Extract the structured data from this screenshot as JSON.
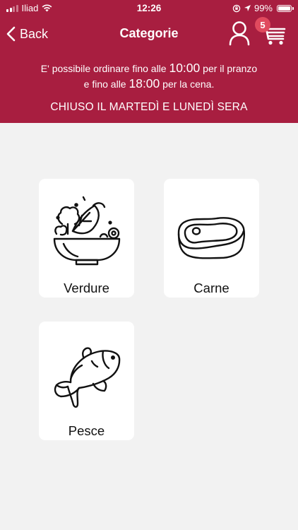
{
  "status_bar": {
    "carrier": "Iliad",
    "time": "12:26",
    "battery": "99%"
  },
  "nav": {
    "back_label": "Back",
    "title": "Categorie",
    "cart_count": "5"
  },
  "info": {
    "line1_prefix": "E' possibile ordinare fino alle",
    "line1_time": "10:00",
    "line1_suffix": "per il pranzo",
    "line2_prefix": "e fino alle",
    "line2_time": "18:00",
    "line2_suffix": "per la cena.",
    "closed_notice": "CHIUSO IL MARTEDÌ E LUNEDÌ SERA"
  },
  "categories": [
    {
      "label": "Verdure",
      "icon": "salad-bowl-icon"
    },
    {
      "label": "Carne",
      "icon": "steak-icon"
    },
    {
      "label": "Pesce",
      "icon": "fish-icon"
    }
  ],
  "colors": {
    "header_bg": "#a81e40",
    "badge_bg": "#e04a5e",
    "page_bg": "#f2f2f2",
    "card_bg": "#ffffff"
  }
}
